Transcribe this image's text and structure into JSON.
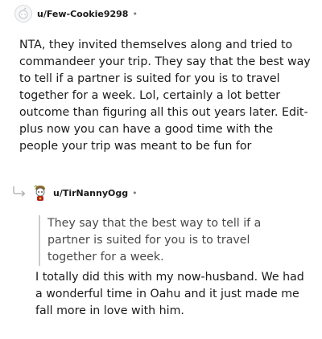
{
  "parent_comment": {
    "username": "u/Few-Cookie9298",
    "separator": "•",
    "avatar_icon": "snoo-outline-avatar-icon",
    "body": "NTA, they invited themselves along and tried to commandeer your trip. They say that the best way to tell if a partner is suited for you is to travel together for a week. Lol, certainly a lot better outcome than figuring all this out years later. Edit- plus now you can have a good time with the people your trip was meant to be fun for"
  },
  "reply_comment": {
    "username": "u/TirNannyOgg",
    "separator": "•",
    "avatar_icon": "snoo-custom-avatar-icon",
    "reply_icon": "reply-arrow-icon",
    "quote": "They say that the best way to tell if a partner is suited for you is to travel together for a week.",
    "body": "I totally did this with my now-husband. We had a wonderful time in Oahu and it just made me fall more in love with him."
  },
  "colors": {
    "text": "#1a1a1b",
    "meta": "#7c7c7c",
    "quote_bar": "#c8cbcd"
  }
}
